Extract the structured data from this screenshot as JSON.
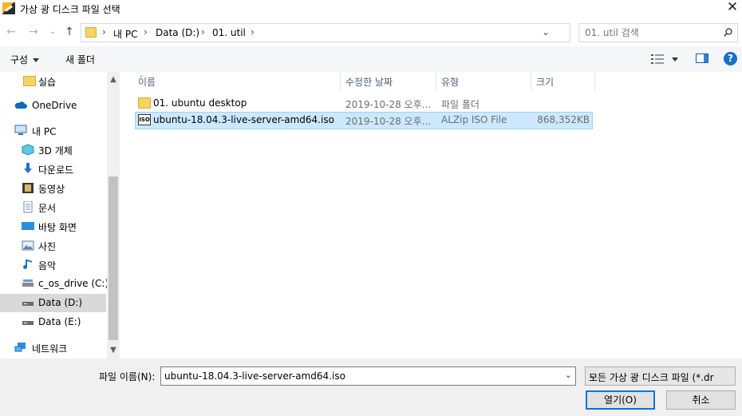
{
  "window": {
    "title": "가상 광 디스크 파일 선택",
    "close_glyph": "✕"
  },
  "nav": {
    "back_glyph": "←",
    "forward_glyph": "→",
    "recent_glyph": "⌄",
    "up_glyph": "↑",
    "breadcrumbs": [
      "내 PC",
      "Data (D:)",
      "01. util"
    ],
    "refresh_glyph": "↻",
    "search_placeholder": "01. util 검색"
  },
  "toolbar": {
    "organize_label": "구성",
    "new_folder_label": "새 폴더"
  },
  "sidebar": {
    "items": [
      {
        "label": "실습",
        "icon": "folder-icon"
      },
      {
        "label": "OneDrive",
        "icon": "cloud-icon"
      },
      {
        "label": "내 PC",
        "icon": "pc-icon"
      },
      {
        "label": "3D 개체",
        "icon": "cube-icon"
      },
      {
        "label": "다운로드",
        "icon": "download-icon"
      },
      {
        "label": "동영상",
        "icon": "video-icon"
      },
      {
        "label": "문서",
        "icon": "document-icon"
      },
      {
        "label": "바탕 화면",
        "icon": "desktop-icon"
      },
      {
        "label": "사진",
        "icon": "pictures-icon"
      },
      {
        "label": "음악",
        "icon": "music-icon"
      },
      {
        "label": "c_os_drive (C:)",
        "icon": "drive-icon"
      },
      {
        "label": "Data (D:)",
        "icon": "drive-icon"
      },
      {
        "label": "Data (E:)",
        "icon": "drive-icon"
      },
      {
        "label": "네트워크",
        "icon": "network-icon"
      }
    ]
  },
  "columns": {
    "name": "이름",
    "date": "수정한 날짜",
    "type": "유형",
    "size": "크기"
  },
  "files": [
    {
      "name": "01. ubuntu desktop",
      "date": "2019-10-28 오후...",
      "type": "파일 폴더",
      "size": "",
      "icon": "folder-icon"
    },
    {
      "name": "ubuntu-18.04.3-live-server-amd64.iso",
      "date": "2019-10-28 오후...",
      "type": "ALZip ISO File",
      "size": "868,352KB",
      "icon": "iso-file-icon",
      "icon_text": "ISO"
    }
  ],
  "bottom": {
    "filename_label": "파일 이름(N):",
    "filename_value": "ubuntu-18.04.3-live-server-amd64.iso",
    "filter_value": "모든 가상 광 디스크 파일 (*.dr",
    "open_label": "열기(O)",
    "cancel_label": "취소"
  }
}
